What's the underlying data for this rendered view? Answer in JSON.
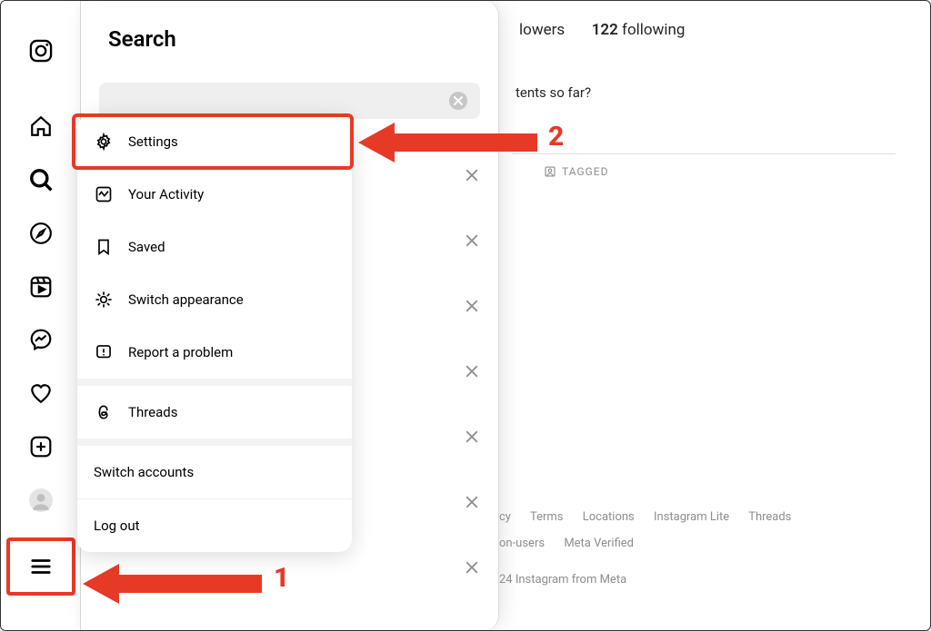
{
  "sidebar": {
    "items": [
      {
        "name": "instagram-logo"
      },
      {
        "name": "home"
      },
      {
        "name": "search",
        "active": true
      },
      {
        "name": "explore"
      },
      {
        "name": "reels"
      },
      {
        "name": "messages"
      },
      {
        "name": "notifications"
      },
      {
        "name": "create"
      },
      {
        "name": "profile"
      }
    ],
    "menu": "menu"
  },
  "search": {
    "title": "Search",
    "clear": "clear"
  },
  "popup": {
    "items": [
      {
        "icon": "gear",
        "label": "Settings"
      },
      {
        "icon": "activity",
        "label": "Your Activity"
      },
      {
        "icon": "bookmark",
        "label": "Saved"
      },
      {
        "icon": "sun",
        "label": "Switch appearance"
      },
      {
        "icon": "alert",
        "label": "Report a problem"
      }
    ],
    "threads_label": "Threads",
    "switch_label": "Switch accounts",
    "logout_label": "Log out"
  },
  "annotations": {
    "one": "1",
    "two": "2"
  },
  "profile": {
    "followers_label": "lowers",
    "following_count": "122",
    "following_label": "following",
    "tagline": "tents so far?",
    "tagged_label": "TAGGED"
  },
  "footer": {
    "links": [
      "cy",
      "Terms",
      "Locations",
      "Instagram Lite",
      "Threads",
      "on-users",
      "Meta Verified"
    ],
    "copyright": "24 Instagram from Meta"
  }
}
